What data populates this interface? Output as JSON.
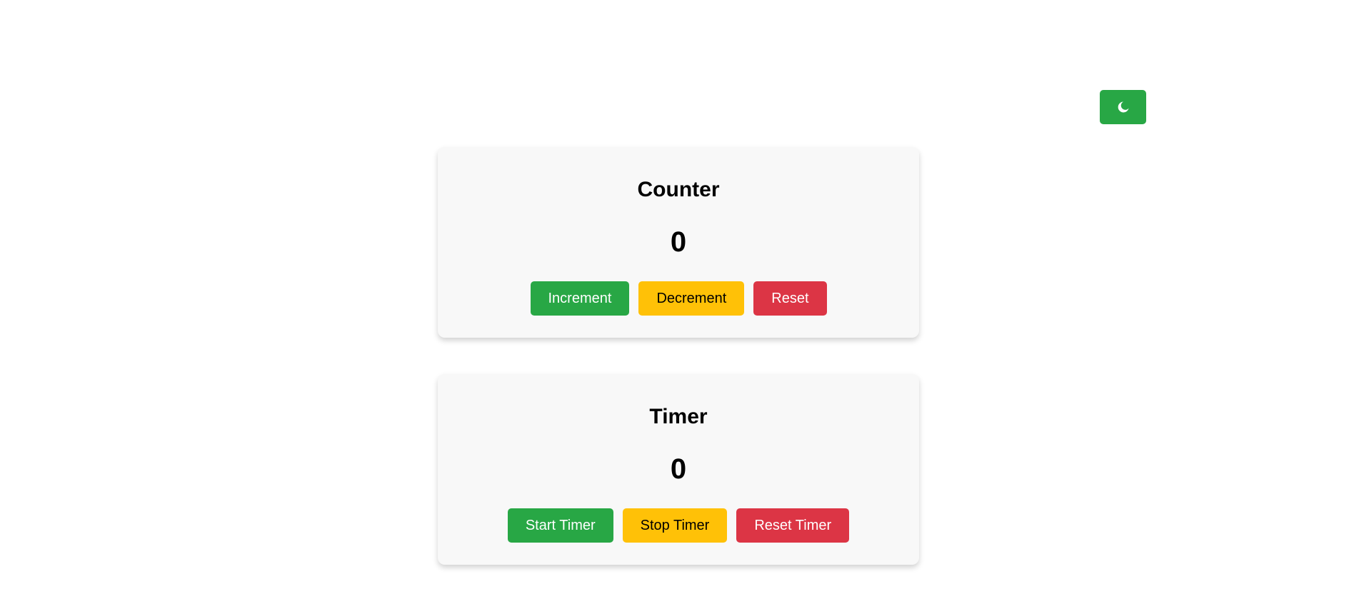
{
  "theme_toggle": {
    "icon": "moon-icon",
    "color": "#28a745"
  },
  "counter": {
    "title": "Counter",
    "value": "0",
    "buttons": {
      "increment": "Increment",
      "decrement": "Decrement",
      "reset": "Reset"
    }
  },
  "timer": {
    "title": "Timer",
    "value": "0",
    "buttons": {
      "start": "Start Timer",
      "stop": "Stop Timer",
      "reset": "Reset Timer"
    }
  },
  "colors": {
    "success": "#28a745",
    "warning": "#ffc107",
    "danger": "#dc3545",
    "card_bg": "#f8f8f8"
  }
}
